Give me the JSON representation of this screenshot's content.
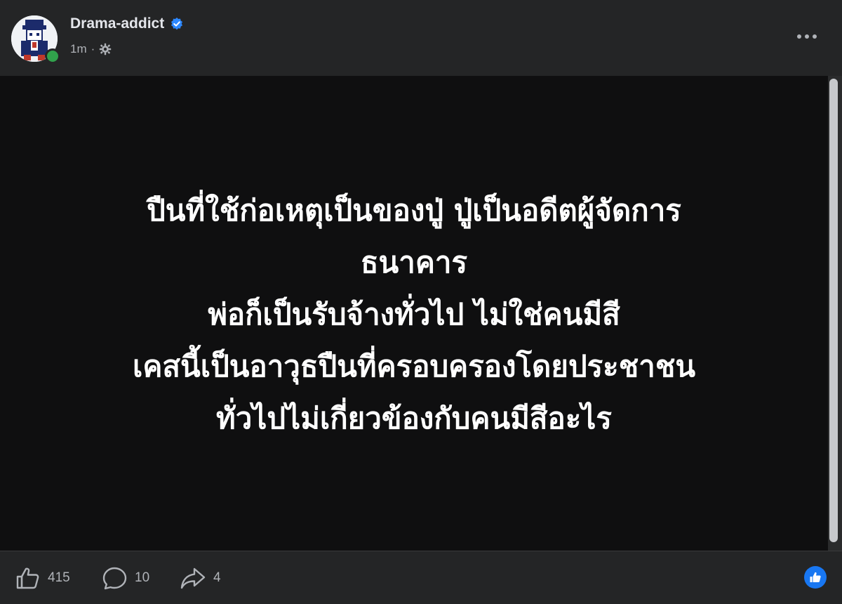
{
  "post": {
    "author": "Drama-addict",
    "timestamp": "1m",
    "separator": "·",
    "privacy_icon": "gear-icon",
    "text_lines": [
      "ปืนที่ใช้ก่อเหตุเป็นของปู่ ปู่เป็นอดีตผู้จัดการ",
      "ธนาคาร",
      "พ่อก็เป็นรับจ้างทั่วไป ไม่ใช่คนมีสี",
      "เคสนี้เป็นอาวุธปืนที่ครอบครองโดยประชาชน",
      "ทั่วไปไม่เกี่ยวข้องกับคนมีสีอะไร"
    ]
  },
  "actions": {
    "likes": "415",
    "comments": "10",
    "shares": "4"
  },
  "colors": {
    "background": "#242526",
    "post_background": "#0f0f10",
    "verified": "#2d88ff",
    "online": "#31a24c",
    "accent": "#1877f2"
  }
}
